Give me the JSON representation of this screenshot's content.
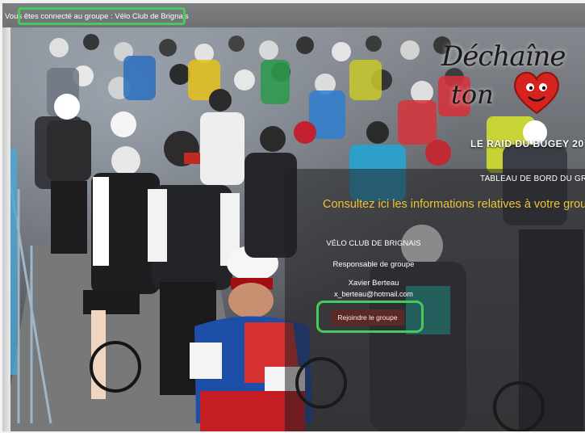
{
  "status_bar": {
    "text": "Vous êtes connecté au groupe : Vélo Club de Brignais"
  },
  "branding": {
    "logo_line1": "Déchaîne",
    "logo_line2": "ton",
    "event_title": "LE RAID DU BUGEY 20"
  },
  "panel": {
    "dashboard_title": "TABLEAU DE BORD DU GROUP",
    "headline": "Consultez ici les informations relatives à votre group",
    "club_name": "VÉLO CLUB DE BRIGNAIS",
    "role_label": "Responsable de groupe",
    "manager_name": "Xavier Berteau",
    "manager_email": "x_berteau@hotmail.com",
    "join_label": "Rejoindre le groupe"
  },
  "colors": {
    "highlight": "#47c95c",
    "headline": "#f0c232",
    "button": "#5b2a24"
  }
}
